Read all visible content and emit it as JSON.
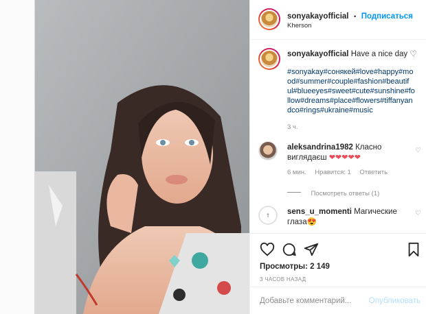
{
  "header": {
    "username": "sonyakayofficial",
    "dot": "•",
    "follow_label": "Подписаться",
    "location": "Kherson"
  },
  "caption": {
    "username": "sonyakayofficial",
    "text": "Have a nice day ♡",
    "hashtags": [
      "#sonyakay#сонякей#love#happy#mo",
      "od#summer#couple#fashion#beautif",
      "ul#blueeyes#sweet#cute#sunshine#fo",
      "llow#dreams#place#flowers#tiffanyan",
      "dco#rings#ukraine#music"
    ],
    "time": "3 ч."
  },
  "comments": [
    {
      "username": "aleksandrina1982",
      "text_line1": "Класно",
      "text_line2": "виглядаєш",
      "hearts": "❤❤❤❤❤",
      "time": "6 мин.",
      "likes": "Нравится: 1",
      "reply": "Ответить",
      "view_replies": "Посмотреть ответы (1)"
    },
    {
      "username": "sens_u_momenti",
      "text_line1": "Магические",
      "text_line2": "глаза",
      "emoji": "😍"
    }
  ],
  "stats": {
    "views": "Просмотры: 2 149",
    "time": "3 ЧАСОВ НАЗАД"
  },
  "add_comment": {
    "placeholder": "Добавьте комментарий...",
    "publish_label": "Опубликовать"
  },
  "colors": {
    "accent": "#0095f6",
    "heart": "#ed4956",
    "text": "#262626",
    "muted": "#8e8e8e"
  },
  "icons": [
    "heart-icon",
    "comment-icon",
    "share-icon",
    "bookmark-icon"
  ]
}
